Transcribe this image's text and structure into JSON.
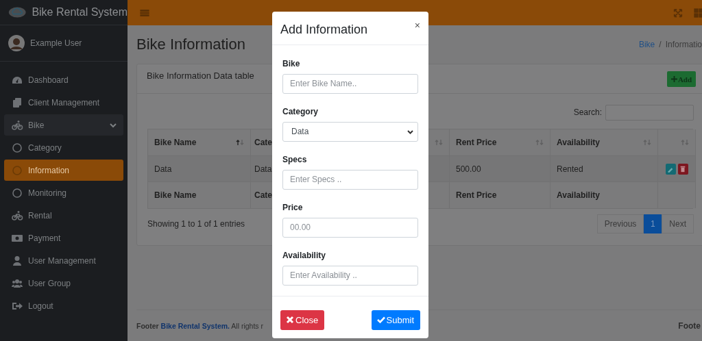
{
  "brand": {
    "title": "Bike Rental System"
  },
  "user": {
    "name": "Example User"
  },
  "nav": [
    {
      "label": "Dashboard",
      "selected": false
    },
    {
      "label": "Client Management",
      "selected": false
    },
    {
      "label": "Bike",
      "selected": false,
      "expanded": true,
      "children": [
        {
          "label": "Category",
          "selected": false
        },
        {
          "label": "Information",
          "selected": true
        },
        {
          "label": "Monitoring",
          "selected": false
        }
      ]
    },
    {
      "label": "Rental",
      "selected": false
    },
    {
      "label": "Payment",
      "selected": false
    },
    {
      "label": "User Management",
      "selected": false
    },
    {
      "label": "User Group",
      "selected": false
    },
    {
      "label": "Logout",
      "selected": false
    }
  ],
  "page": {
    "title": "Bike Information",
    "breadcrumb": [
      {
        "label": "Bike",
        "kind": "link"
      },
      {
        "label": "/",
        "kind": "separator"
      },
      {
        "label": "Informatio",
        "kind": "current"
      }
    ]
  },
  "card": {
    "title": "Bike Information Data table",
    "add_button": "Add",
    "search_label": "Search:",
    "columns": [
      {
        "label": "Bike Name",
        "sorted": true
      },
      {
        "label": "Cate",
        "sorted": false
      },
      {
        "label": "Rent Price",
        "sorted": false
      },
      {
        "label": "Availability",
        "sorted": false
      },
      {
        "sorted": false
      }
    ],
    "rows": [
      {
        "cells": [
          "Data",
          "Data",
          "500.00",
          "Rented"
        ]
      }
    ],
    "footer_columns": [
      "Bike Name",
      "Cate",
      "Rent Price",
      "Availability"
    ],
    "info": "Showing 1 to 1 of 1 entries",
    "pagination": [
      {
        "label": "Previous",
        "selected": false
      },
      {
        "label": "1",
        "selected": true
      },
      {
        "label": "Next",
        "selected": false
      }
    ]
  },
  "footer": {
    "prefix": "Footer",
    "link": "Bike Rental System.",
    "suffix": "All rights r",
    "right": "Foote"
  },
  "modal": {
    "title": "Add Information",
    "close": "×",
    "fields": [
      {
        "label": "Bike",
        "kind": "text",
        "placeholder": "Enter Bike Name.."
      },
      {
        "label": "Category",
        "kind": "select",
        "value": "Data"
      },
      {
        "label": "Specs",
        "kind": "text",
        "placeholder": "Enter Specs .."
      },
      {
        "label": "Price",
        "kind": "text",
        "placeholder": "00.00"
      },
      {
        "label": "Availability",
        "kind": "text",
        "placeholder": "Enter Availability .."
      }
    ],
    "buttons": [
      {
        "label": "Close",
        "kind": "danger"
      },
      {
        "label": "Submit",
        "kind": "primary"
      }
    ]
  }
}
